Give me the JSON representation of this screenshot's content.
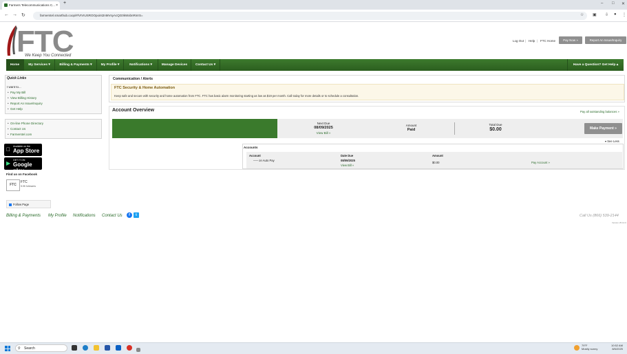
{
  "browser": {
    "tab_title": "Farmers Telecommunications C...",
    "tab_close": "×",
    "new_tab": "+",
    "url": "farmerstel.smarthub.coop/#/VIVIUSROOpoint2nMVsyAcQG0kWxbnRnIrS=",
    "win_min": "–",
    "win_max": "□",
    "win_close": "✕"
  },
  "header": {
    "logo_text": "FTC",
    "tagline": "We Keep You Connected",
    "links": [
      "Log Out",
      "Help",
      "FTC Home"
    ],
    "pay_now": "Pay Now »",
    "report_issue": "Report An Issue/Inquiry"
  },
  "nav": {
    "items": [
      "Home",
      "My Services ▾",
      "Billing & Payments ▾",
      "My Profile ▾",
      "Notifications ▾",
      "Manage Devices",
      "Contact Us ▾"
    ],
    "help": "Have a Question? Get Help ▴"
  },
  "quick_links": {
    "title": "Quick Links",
    "want": "I want to...",
    "links": [
      "Pay My Bill",
      "View Billing History",
      "Report An Issue/Inquiry",
      "Get Help"
    ],
    "links2": [
      "On-line Phone Directory",
      "Contact Us",
      "Farmerstel.com"
    ]
  },
  "stores": {
    "apple_small": "Available on the",
    "apple_big": "App Store",
    "google_small": "GET IT ON",
    "google_big": "Google play"
  },
  "facebook": {
    "find": "Find us on Facebook",
    "box": "FTC",
    "name": "FTC",
    "followers": "5.9K followers",
    "follow": "Follow Page"
  },
  "communication": {
    "title": "Communication / Alerts",
    "alert_title": "FTC Security & Home Automation",
    "alert_body": "Keep safe and secure with security and home automation from FTC. FTC has basic alarm monitoring starting as low as $19 per month. Call today for more details or to schedule a consultation."
  },
  "overview": {
    "title": "Account Overview",
    "pay_all": "Pay all outstanding balances »",
    "next_due_label": "Next Due",
    "next_due_date": "08/09/2025",
    "view_bill": "View Bill »",
    "amount_label": "Amount",
    "amount_value": "Paid",
    "total_due_label": "Total Due",
    "total_due_value": "$0.00",
    "make_payment": "Make Payment »",
    "see_less": "▾ See Less"
  },
  "accounts": {
    "title": "Accounts",
    "headers": [
      "Account",
      "Date Due",
      "Amount"
    ],
    "row": {
      "account": "––– on Auto Pay",
      "date_due": "08/09/2025",
      "view_bill": "View Bill »",
      "amount": "$0.00",
      "pay": "Pay Account »"
    }
  },
  "footer": {
    "links": [
      "Billing & Payments",
      "My Profile",
      "Notifications",
      "Contact Us"
    ],
    "facebook": "f",
    "twitter": "t",
    "call": "Call Us (866) 539-2144",
    "version": "Version 25.10.0"
  },
  "taskbar": {
    "search": "Search",
    "weather_temp": "79°F",
    "weather_desc": "Mostly sunny",
    "time": "10:52 AM",
    "date": "8/6/2025"
  },
  "colors": {
    "nav_green": "#2b5e1f",
    "link_green": "#2a6b2a",
    "button_grey": "#8f8f8f",
    "alert_bg": "#fcf7e8"
  }
}
